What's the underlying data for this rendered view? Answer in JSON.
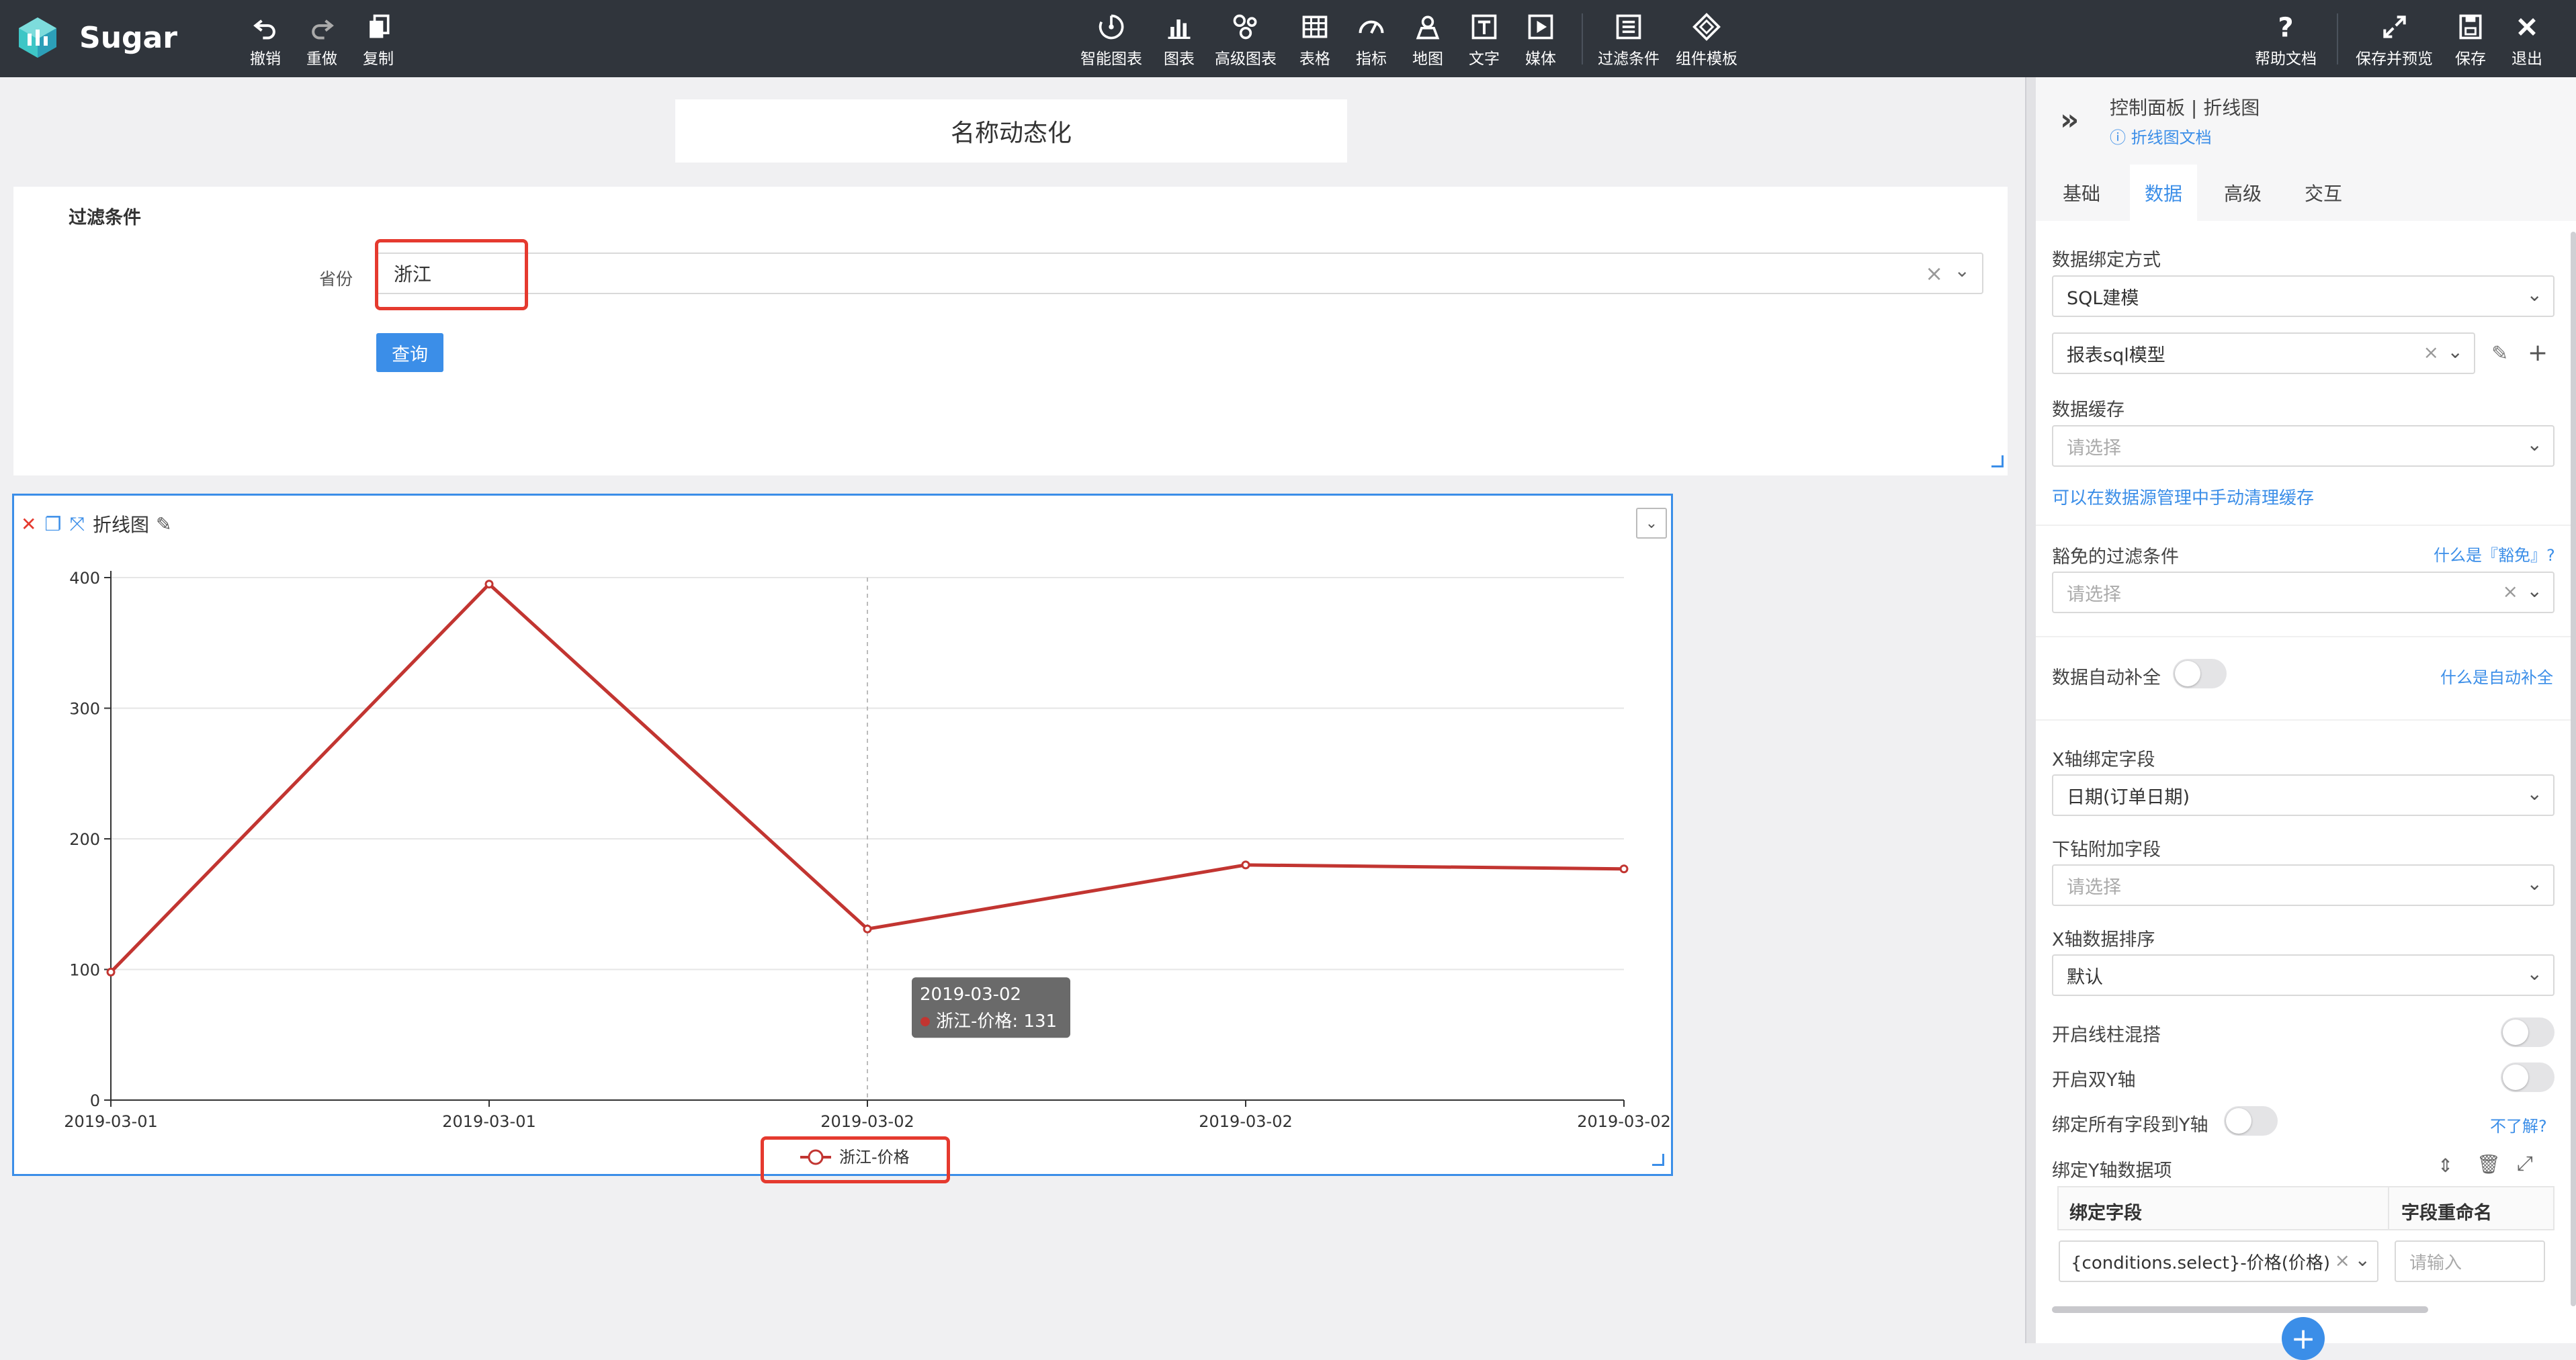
{
  "app": {
    "name": "Sugar"
  },
  "toolbar": {
    "left": [
      {
        "id": "undo",
        "label": "撤销",
        "icon": "undo-icon"
      },
      {
        "id": "redo",
        "label": "重做",
        "icon": "redo-icon"
      },
      {
        "id": "copy",
        "label": "复制",
        "icon": "copy-icon"
      }
    ],
    "center": [
      {
        "id": "smart-chart",
        "label": "智能图表",
        "icon": "smart-chart-icon"
      },
      {
        "id": "chart",
        "label": "图表",
        "icon": "bar-chart-icon"
      },
      {
        "id": "adv-chart",
        "label": "高级图表",
        "icon": "advanced-chart-icon"
      },
      {
        "id": "table",
        "label": "表格",
        "icon": "table-icon"
      },
      {
        "id": "metric",
        "label": "指标",
        "icon": "gauge-icon"
      },
      {
        "id": "map",
        "label": "地图",
        "icon": "map-pin-icon"
      },
      {
        "id": "text",
        "label": "文字",
        "icon": "text-icon"
      },
      {
        "id": "media",
        "label": "媒体",
        "icon": "media-icon"
      },
      {
        "id": "filter",
        "label": "过滤条件",
        "icon": "filter-icon"
      },
      {
        "id": "template",
        "label": "组件模板",
        "icon": "template-icon"
      }
    ],
    "right": [
      {
        "id": "help",
        "label": "帮助文档",
        "icon": "help-icon"
      },
      {
        "id": "save-preview",
        "label": "保存并预览",
        "icon": "expand-icon"
      },
      {
        "id": "save",
        "label": "保存",
        "icon": "save-icon"
      },
      {
        "id": "exit",
        "label": "退出",
        "icon": "close-icon"
      }
    ]
  },
  "page_title": "名称动态化",
  "filter": {
    "title": "过滤条件",
    "field_label": "省份",
    "field_value": "浙江",
    "query_label": "查询"
  },
  "chart_panel": {
    "title": "折线图"
  },
  "chart_data": {
    "type": "line",
    "title": "",
    "xlabel": "",
    "ylabel": "",
    "categories": [
      "2019-03-01",
      "2019-03-01",
      "2019-03-02",
      "2019-03-02",
      "2019-03-02"
    ],
    "series": [
      {
        "name": "浙江-价格",
        "values": [
          98,
          395,
          131,
          180,
          177
        ],
        "color": "#c23531"
      }
    ],
    "ylim": [
      0,
      400
    ],
    "yticks": [
      0,
      100,
      200,
      300,
      400
    ],
    "grid": true,
    "legend_position": "bottom-center",
    "tooltip": {
      "title": "2019-03-02",
      "text": "浙江-价格: 131",
      "index": 2
    }
  },
  "right_panel": {
    "header": "控制面板 | 折线图",
    "doc_link": "折线图文档",
    "tabs": [
      "基础",
      "数据",
      "高级",
      "交互"
    ],
    "active_tab": "数据",
    "binding_mode_label": "数据绑定方式",
    "binding_mode_value": "SQL建模",
    "model_value": "报表sql模型",
    "cache_label": "数据缓存",
    "cache_placeholder": "请选择",
    "cache_link": "可以在数据源管理中手动清理缓存",
    "immune_label": "豁免的过滤条件",
    "immune_help": "什么是『豁免』?",
    "immune_placeholder": "请选择",
    "autofill_label": "数据自动补全",
    "autofill_help": "什么是自动补全",
    "x_field_label": "X轴绑定字段",
    "x_field_value": "日期(订单日期)",
    "drill_label": "下钻附加字段",
    "drill_placeholder": "请选择",
    "x_sort_label": "X轴数据排序",
    "x_sort_value": "默认",
    "bar_mix_label": "开启线柱混搭",
    "dual_y_label": "开启双Y轴",
    "bind_all_label": "绑定所有字段到Y轴",
    "bind_all_help": "不了解?",
    "y_items_label": "绑定Y轴数据项",
    "grid_col1": "绑定字段",
    "grid_col2": "字段重命名",
    "y_field_value": "{conditions.select}-价格(价格)",
    "rename_placeholder": "请输入"
  }
}
